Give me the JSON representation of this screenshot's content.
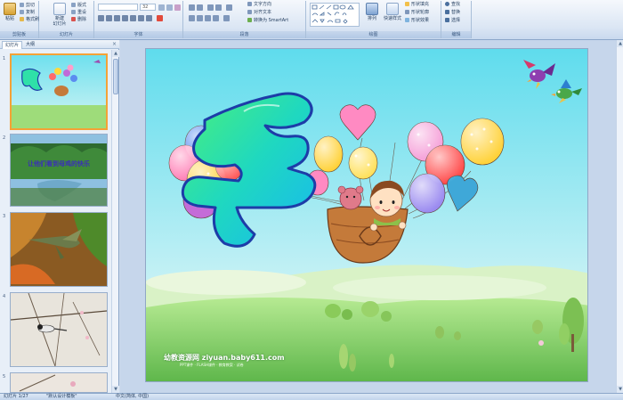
{
  "ribbon": {
    "clipboard": {
      "paste": "粘贴",
      "cut": "剪切",
      "copy": "复制",
      "format_painter": "格式刷",
      "label": "剪贴板"
    },
    "slides": {
      "new_slide": "新建\n幻灯片",
      "layout": "版式",
      "reset": "重设",
      "delete": "删除",
      "label": "幻灯片"
    },
    "font": {
      "font_name": "",
      "font_size": "32",
      "label": "字体"
    },
    "paragraph": {
      "text_direction": "文字方向",
      "align_text": "对齐文本",
      "smartart": "转换为 SmartArt",
      "label": "段落"
    },
    "drawing": {
      "arrange": "排列",
      "quick_styles": "快速样式",
      "shape_fill": "形状填充",
      "shape_outline": "形状轮廓",
      "shape_effects": "形状效果",
      "label": "绘图"
    },
    "editing": {
      "find": "查找",
      "replace": "替换",
      "select": "选择",
      "label": "编辑"
    }
  },
  "panel": {
    "tab_slides": "幻灯片",
    "tab_outline": "大纲",
    "close": "×",
    "thumbs": [
      {
        "num": "1",
        "caption": ""
      },
      {
        "num": "2",
        "caption": "让他们看到母鸡的快乐"
      },
      {
        "num": "3",
        "caption": ""
      },
      {
        "num": "4",
        "caption": ""
      },
      {
        "num": "5",
        "caption": ""
      }
    ]
  },
  "slide": {
    "watermark_title": "幼教资源网 ziyuan.baby611.com",
    "watermark_sub": "PPT课件 · FLASH课件 · 教育教案 · 试卷"
  },
  "status": {
    "slide_pos": "幻灯片 1/27",
    "theme": "\"默认设计模板\"",
    "language": "中文(简体, 中国)"
  },
  "colors": {
    "ribbon_bg": "#dbe6f4",
    "sky_top": "#6fe0ee",
    "sky_bottom": "#c6f1f5",
    "grass": "#8fd46a",
    "active_thumb": "#f4a236",
    "title_glyph": "#2fe0a8"
  }
}
